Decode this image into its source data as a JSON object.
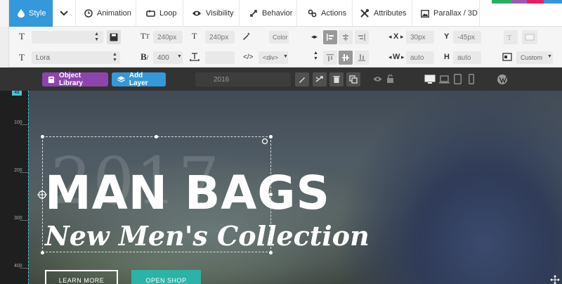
{
  "tabs": [
    {
      "label": "Style",
      "icon": "drop-icon",
      "active": true
    },
    {
      "label": "",
      "icon": "chevron-down-icon",
      "active": false
    },
    {
      "label": "Animation",
      "icon": "clock-icon",
      "active": false
    },
    {
      "label": "Loop",
      "icon": "loop-icon",
      "active": false
    },
    {
      "label": "Visibility",
      "icon": "eye-icon",
      "active": false
    },
    {
      "label": "Behavior",
      "icon": "behavior-icon",
      "active": false
    },
    {
      "label": "Actions",
      "icon": "link-icon",
      "active": false
    },
    {
      "label": "Attributes",
      "icon": "wrench-icon",
      "active": false
    },
    {
      "label": "Parallax / 3D",
      "icon": "image-icon",
      "active": false
    }
  ],
  "style_row1": {
    "font_size": "240px",
    "line_height": "240px",
    "color_label": "Color",
    "x_value": "30px",
    "y_value": "-45px",
    "x_label": "X",
    "y_label": "Y"
  },
  "style_row2": {
    "font_family": "Lora",
    "font_weight": "400",
    "tag": "<div>",
    "w_value": "auto",
    "h_value": "auto",
    "w_label": "W",
    "h_label": "H",
    "size_mode": "Custom"
  },
  "toolbar": {
    "object_library": "Object Library",
    "add_layer": "Add Layer",
    "layer_name": "2016"
  },
  "ruler": {
    "top_label": "43",
    "marks": [
      "100",
      "200",
      "300",
      "400"
    ]
  },
  "slide": {
    "year_bg": "2017",
    "headline": "MAN BAGS",
    "subheadline": "New Men's Collection",
    "button1": "LEARN MORE",
    "button2": "OPEN SHOP"
  },
  "colors": {
    "accent": "#3498db",
    "library": "#8e44ad",
    "teal": "#2bb3a7"
  }
}
